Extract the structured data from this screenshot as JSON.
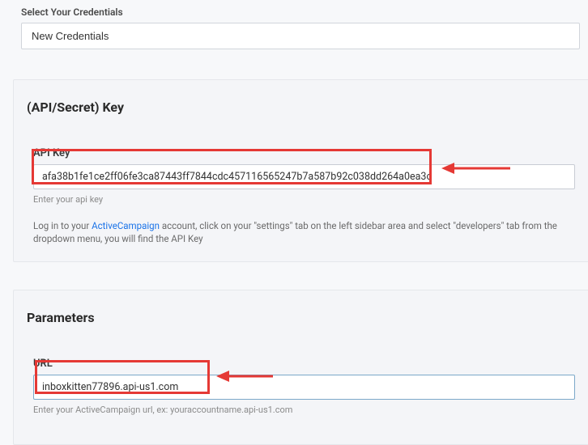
{
  "credentials": {
    "label": "Select Your Credentials",
    "value": "New Credentials"
  },
  "apiSection": {
    "title": "(API/Secret) Key",
    "field_label": "API Key",
    "field_value": "afa38b1fe1ce2ff06fe3ca87443ff7844cdc457116565247b7a587b92c038dd264a0ea3c",
    "hint": "Enter your api key",
    "help_prefix": "Log in to your ",
    "help_link": "ActiveCampaign",
    "help_suffix": " account, click on your \"settings\" tab on the left sidebar area and select \"developers\" tab from the dropdown menu, you will find the API Key"
  },
  "paramsSection": {
    "title": "Parameters",
    "url_label": "URL",
    "url_value": "inboxkitten77896.api-us1.com",
    "url_hint": "Enter your ActiveCampaign url, ex: youraccountname.api-us1.com"
  },
  "colors": {
    "highlight": "#e53935",
    "link": "#1a73e8"
  }
}
